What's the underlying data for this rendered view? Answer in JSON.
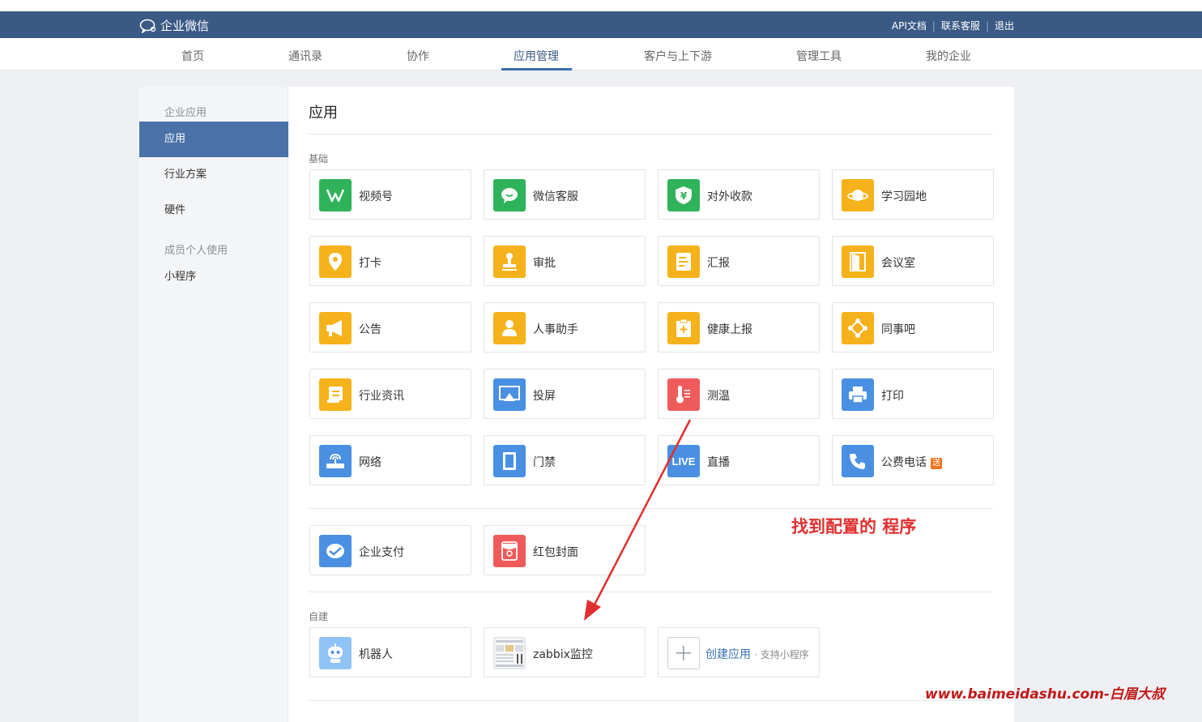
{
  "topbar": {
    "brand": "企业微信",
    "links": [
      "API文档",
      "联系客服",
      "退出"
    ]
  },
  "nav": {
    "items": [
      "首页",
      "通讯录",
      "协作",
      "应用管理",
      "客户与上下游",
      "管理工具",
      "我的企业"
    ],
    "active": "应用管理"
  },
  "sidebar": {
    "group1": "企业应用",
    "items1": [
      "应用",
      "行业方案",
      "硬件"
    ],
    "group2": "成员个人使用",
    "items2": [
      "小程序"
    ],
    "active": "应用"
  },
  "main": {
    "title": "应用",
    "section_basic": "基础",
    "section_custom": "自建",
    "basic_apps": [
      {
        "label": "视频号",
        "icon": "channels-icon",
        "color": "#2fb35a"
      },
      {
        "label": "微信客服",
        "icon": "chat-bubble-icon",
        "color": "#2fb35a"
      },
      {
        "label": "对外收款",
        "icon": "yuan-shield-icon",
        "color": "#2fb35a"
      },
      {
        "label": "学习园地",
        "icon": "planet-icon",
        "color": "#f6b21b"
      },
      {
        "label": "打卡",
        "icon": "location-pin-icon",
        "color": "#f6b21b"
      },
      {
        "label": "审批",
        "icon": "stamp-icon",
        "color": "#f6b21b"
      },
      {
        "label": "汇报",
        "icon": "report-doc-icon",
        "color": "#f6b21b"
      },
      {
        "label": "会议室",
        "icon": "door-icon",
        "color": "#f6b21b"
      },
      {
        "label": "公告",
        "icon": "megaphone-icon",
        "color": "#f6b21b"
      },
      {
        "label": "人事助手",
        "icon": "person-icon",
        "color": "#f6b21b"
      },
      {
        "label": "健康上报",
        "icon": "health-clipboard-icon",
        "color": "#f6b21b"
      },
      {
        "label": "同事吧",
        "icon": "network-nodes-icon",
        "color": "#f6b21b"
      },
      {
        "label": "行业资讯",
        "icon": "news-scroll-icon",
        "color": "#f6b21b"
      },
      {
        "label": "投屏",
        "icon": "screen-cast-icon",
        "color": "#4a90e2"
      },
      {
        "label": "测温",
        "icon": "thermometer-icon",
        "color": "#ef5b5b"
      },
      {
        "label": "打印",
        "icon": "printer-icon",
        "color": "#4a90e2"
      },
      {
        "label": "网络",
        "icon": "router-icon",
        "color": "#4a90e2"
      },
      {
        "label": "门禁",
        "icon": "door-access-icon",
        "color": "#4a90e2"
      },
      {
        "label": "直播",
        "icon": "live-icon",
        "color": "#4a90e2",
        "icon_text": "LIVE"
      },
      {
        "label": "公费电话",
        "icon": "phone-icon",
        "color": "#4a90e2",
        "badge": "送"
      }
    ],
    "pay_apps": [
      {
        "label": "企业支付",
        "icon": "payment-icon",
        "color": "#4a90e2"
      },
      {
        "label": "红包封面",
        "icon": "red-packet-icon",
        "color": "#ef5b5b"
      }
    ],
    "custom_apps": [
      {
        "label": "机器人",
        "icon": "robot-icon",
        "color": "#8fc3f5"
      },
      {
        "label": "zabbix监控",
        "icon": "dashboard-thumbnail-icon",
        "color": "#eef2f7"
      }
    ],
    "create": {
      "label": "创建应用",
      "sub": "· 支持小程序"
    }
  },
  "annotation": "找到配置的 程序",
  "watermark": "www.baimeidashu.com-白眉大叔"
}
